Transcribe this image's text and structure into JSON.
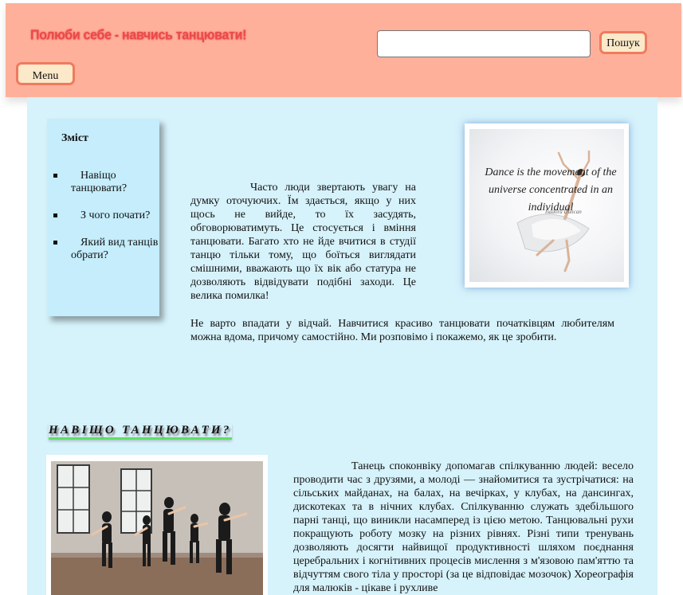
{
  "header": {
    "title": "Полюби себе - навчись танцювати!",
    "search": {
      "placeholder": "",
      "value": "",
      "button_label": "Пошук"
    },
    "menu_label": "Menu"
  },
  "toc": {
    "title": "Зміст",
    "items": [
      {
        "label": "Навіщо танцювати?"
      },
      {
        "label": "З чого почати?"
      },
      {
        "label": "Який вид танців обрати?"
      }
    ]
  },
  "intro": {
    "paragraph1": "Часто люди звертають увагу на думку оточуючих. Їм здається, якщо у них щось не вийде, то їх засудять, обговорюватимуть. Це стосується і вміння танцювати. Багато хто не йде вчитися в студії танцю тільки тому, що боїться виглядати смішними, вважають що їх вік або статура не дозволяють відвідувати подібні заходи. Це велика помилка!",
    "paragraph2": "Не варто впадати у відчай. Навчитися красиво танцювати початківцям любителям можна вдома, причому самостійно. Ми розповімо і покажемо, як це зробити."
  },
  "hero_image": {
    "quote": "Dance is the movement of the universe concentrated in an individual",
    "author": "Isadora Duncan"
  },
  "section1": {
    "heading": "НАВІЩО ТАНЦЮВАТИ?",
    "body": "Танець споконвіку допомагав спілкуванню людей: весело проводити час з друзями, а молоді — знайомитися та зустрічатися: на сільських майданах, на балах, на вечірках, у клубах, на дансингах, дискотеках та в нічних клубах. Спілкуванню служать здебільшого парні танці, що виникли насамперед із цією метою. Танцювальні рухи покращують роботу мозку на різних рівнях. Різні типи тренувань дозволяють досягти найвищої продуктивності шляхом поєднання церебральних і когнітивних процесів мислення з м'язовою пам'яттю та відчуттям свого тіла у просторі (за це відповідає мозочок) Хореографія для малюків - цікаве і рухливе"
  },
  "colors": {
    "header_bg": "#ffb09a",
    "title_color": "#ea4a4a",
    "button_border": "#f07a5f",
    "button_bg": "#fbe9c9",
    "main_bg": "#d6f2fb",
    "toc_bg": "#c5edfc",
    "heading_underline": "#5fe05f"
  },
  "icons": [
    "list-bullet-icon"
  ]
}
